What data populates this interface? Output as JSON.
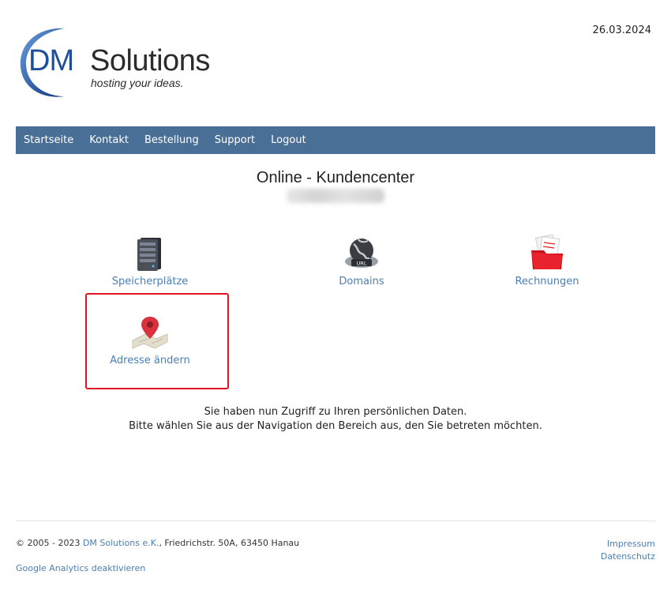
{
  "header": {
    "date": "26.03.2024",
    "logo": {
      "dm": "DM",
      "word": "Solutions",
      "tagline": "hosting your ideas."
    }
  },
  "nav": {
    "items": [
      "Startseite",
      "Kontakt",
      "Bestellung",
      "Support",
      "Logout"
    ]
  },
  "main": {
    "title": "Online - Kundencenter",
    "tiles": [
      {
        "label": "Speicherplätze",
        "icon": "server-icon"
      },
      {
        "label": "Domains",
        "icon": "globe-url-icon"
      },
      {
        "label": "Rechnungen",
        "icon": "folder-invoices-icon"
      },
      {
        "label": "Adresse ändern",
        "icon": "map-pin-icon"
      }
    ],
    "info_line1": "Sie haben nun Zugriff zu Ihren persönlichen Daten.",
    "info_line2": "Bitte wählen Sie aus der Navigation den Bereich aus, den Sie betreten möchten."
  },
  "footer": {
    "copyright_prefix": "© 2005 - 2023 ",
    "company_link": "DM Solutions e.K.",
    "copyright_suffix": ", Friedrichstr. 50A, 63450 Hanau",
    "ga_link": "Google Analytics deaktivieren",
    "impressum": "Impressum",
    "datenschutz": "Datenschutz"
  },
  "colors": {
    "nav_bg": "#4a6f96",
    "link": "#4a7fb4",
    "highlight": "#e0141c",
    "logo_blue": "#1f4f9c"
  }
}
